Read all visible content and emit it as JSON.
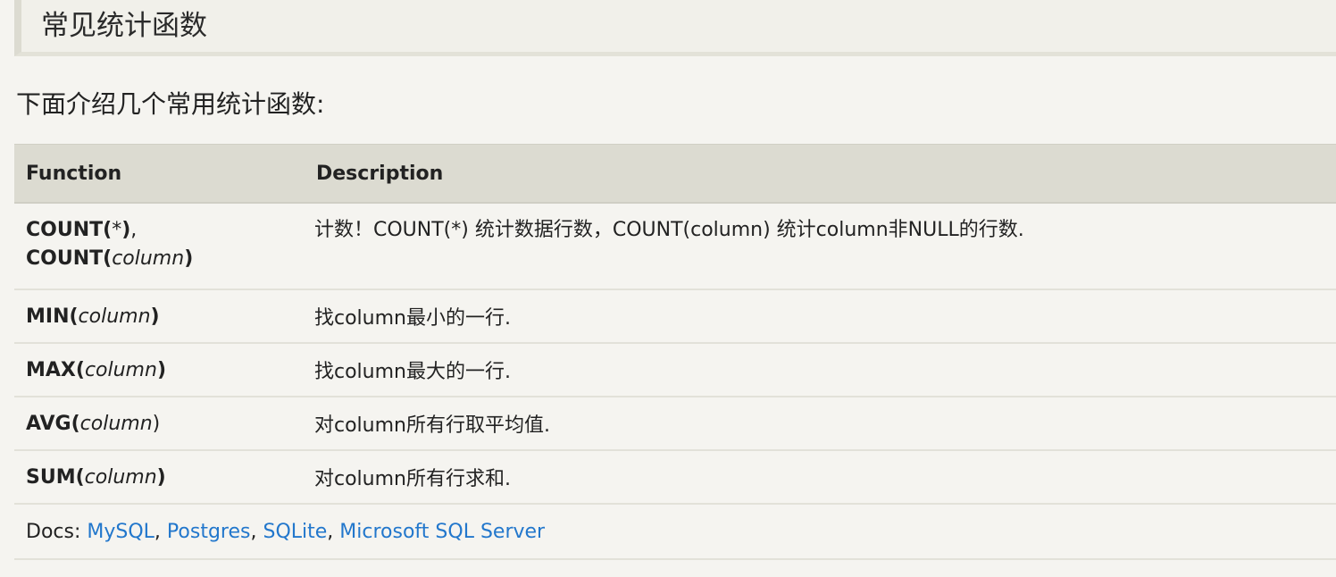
{
  "section": {
    "title": "常见统计函数"
  },
  "intro": "下面介绍几个常用统计函数:",
  "table": {
    "headers": {
      "function": "Function",
      "description": "Description"
    },
    "rows": [
      {
        "func_name": "COUNT(",
        "func_arg": "*",
        "func_close": ")",
        "sep": ",",
        "func2_name": "COUNT(",
        "func2_arg": "column",
        "func2_close": ")",
        "description": "计数！COUNT(*) 统计数据行数，COUNT(column) 统计column非NULL的行数."
      },
      {
        "func_name": "MIN(",
        "func_arg": "column",
        "func_close": ")",
        "description": "找column最小的一行."
      },
      {
        "func_name": "MAX(",
        "func_arg": "column",
        "func_close": ")",
        "description": "找column最大的一行."
      },
      {
        "func_name": "AVG(",
        "func_arg": "column",
        "func_close": ")",
        "description": "对column所有行取平均值."
      },
      {
        "func_name": "SUM(",
        "func_arg": "column",
        "func_close": ")",
        "description": "对column所有行求和."
      }
    ],
    "docs": {
      "label": "Docs: ",
      "links": [
        "MySQL",
        "Postgres",
        "SQLite",
        "Microsoft SQL Server"
      ],
      "separator": ", "
    }
  },
  "colors": {
    "link": "#2277cc",
    "header_bg": "#dcdbd1",
    "page_bg": "#f5f4f0"
  }
}
